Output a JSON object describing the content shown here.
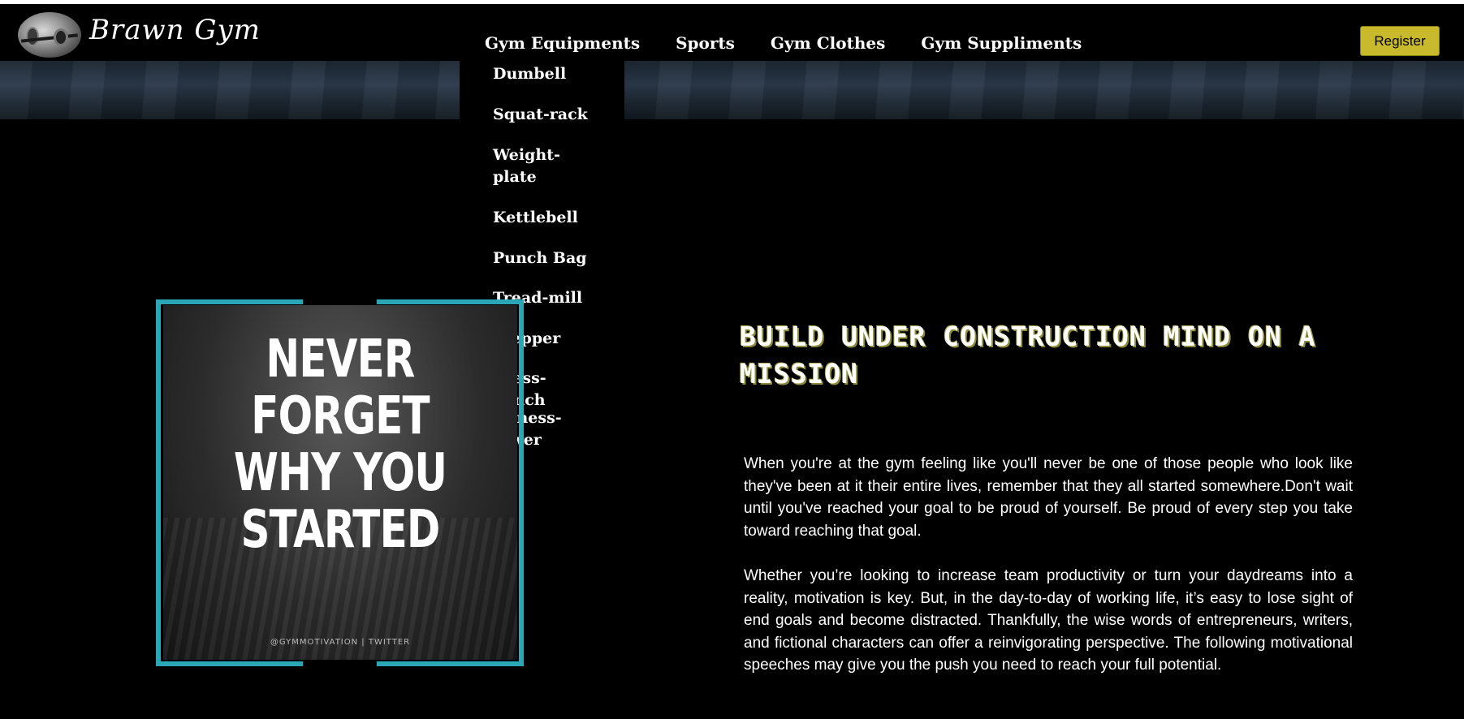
{
  "brand": {
    "name": "Brawn Gym"
  },
  "nav": {
    "links": [
      "Gym Equipments",
      "Sports",
      "Gym Clothes",
      "Gym Suppliments"
    ],
    "register_label": "Register"
  },
  "dropdown": {
    "items": [
      "Dumbell",
      "Squat-rack",
      "Weight-plate",
      "Kettlebell",
      "Punch Bag",
      "Tread-mill",
      "Stepper",
      "Press-bench",
      "Fitness-tower"
    ]
  },
  "poster": {
    "lines": [
      "NEVER",
      "FORGET",
      "WHY YOU",
      "STARTED"
    ],
    "credit": "@GYMMOTIVATION | TWITTER"
  },
  "main": {
    "headline": "BUILD UNDER CONSTRUCTION MIND ON A MISSION",
    "paragraph1": "When you're at the gym feeling like you'll never be one of those people who look like they've been at it their entire lives, remember that they all started somewhere.Don't wait until you've reached your goal to be proud of yourself. Be proud of every step you take toward reaching that goal.",
    "paragraph2": "Whether you’re looking to increase team productivity or turn your daydreams into a reality, motivation is key. But, in the day-to-day of working life, it’s easy to lose sight of end goals and become distracted. Thankfully, the wise words of entrepreneurs, writers, and fictional characters can offer a reinvigorating perspective. The following motivational speeches may give you the push you need to reach your full potential."
  },
  "colors": {
    "accent": "#c9b92c",
    "frame": "#2aa6b7",
    "background": "#000000"
  }
}
